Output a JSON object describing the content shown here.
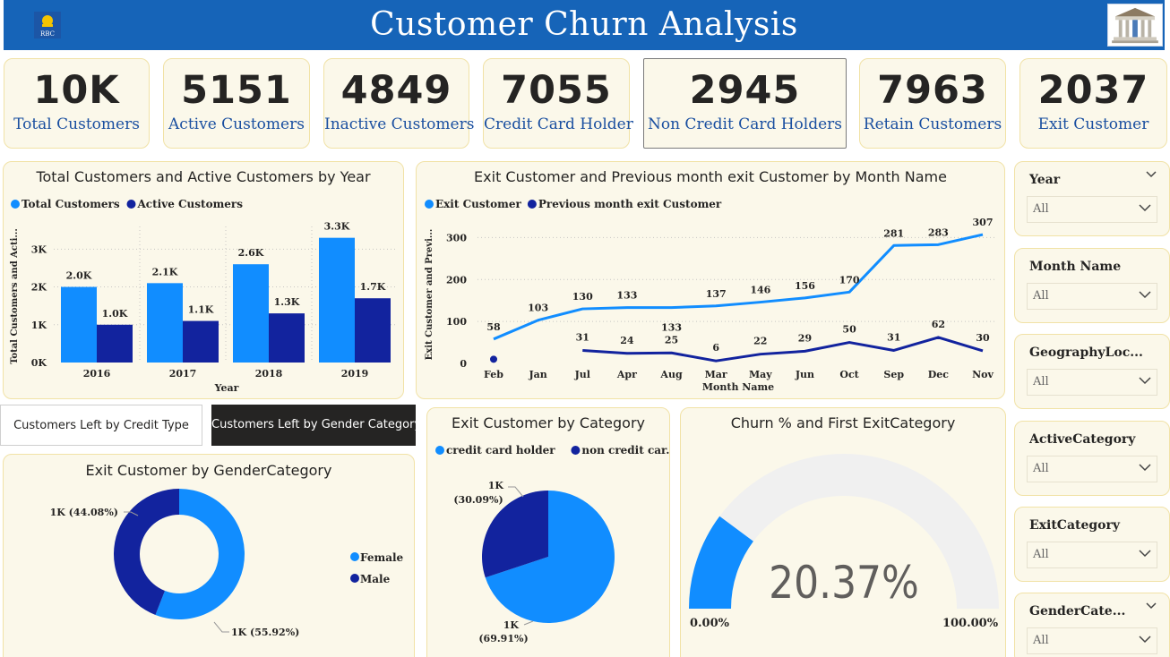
{
  "header": {
    "title": "Customer Churn Analysis",
    "logo_text": "RBC",
    "colors": {
      "header_bg": "#1664b8",
      "panel_bg": "#fbf8ea",
      "primary_blue": "#118dff",
      "dark_blue": "#12239e"
    }
  },
  "cards": [
    {
      "value": "10K",
      "label": "Total Customers"
    },
    {
      "value": "5151",
      "label": "Active Customers"
    },
    {
      "value": "4849",
      "label": "Inactive Customers"
    },
    {
      "value": "7055",
      "label": "Credit Card Holder"
    },
    {
      "value": "2945",
      "label": "Non Credit Card Holders"
    },
    {
      "value": "7963",
      "label": "Retain Customers"
    },
    {
      "value": "2037",
      "label": "Exit Customer"
    }
  ],
  "buttons": {
    "credit_type": "Customers Left by Credit Type",
    "gender_category": "Customers Left by Gender Category"
  },
  "slicers": [
    {
      "title": "Year",
      "value": "All"
    },
    {
      "title": "Month Name",
      "value": "All"
    },
    {
      "title": "GeographyLoc...",
      "value": "All"
    },
    {
      "title": "ActiveCategory",
      "value": "All"
    },
    {
      "title": "ExitCategory",
      "value": "All"
    },
    {
      "title": "GenderCate...",
      "value": "All"
    }
  ],
  "chart_data": [
    {
      "type": "bar",
      "title": "Total Customers and Active Customers by Year",
      "xlabel": "Year",
      "ylabel": "Total Customers and Acti...",
      "categories": [
        "2016",
        "2017",
        "2018",
        "2019"
      ],
      "series": [
        {
          "name": "Total Customers",
          "values": [
            2.0,
            2.1,
            2.6,
            3.3
          ],
          "labels": [
            "2.0K",
            "2.1K",
            "2.6K",
            "3.3K"
          ],
          "color": "#118dff"
        },
        {
          "name": "Active Customers",
          "values": [
            1.0,
            1.1,
            1.3,
            1.7
          ],
          "labels": [
            "1.0K",
            "1.1K",
            "1.3K",
            "1.7K"
          ],
          "color": "#12239e"
        }
      ],
      "yticks": [
        "0K",
        "1K",
        "2K",
        "3K"
      ],
      "ylim": [
        0,
        3.6
      ],
      "unit": "thousands",
      "legend": "top-left",
      "grid": true
    },
    {
      "type": "line",
      "title": "Exit Customer and Previous month exit Customer by Month Name",
      "xlabel": "Month Name",
      "ylabel": "Exit Customer and Previ...",
      "categories": [
        "Feb",
        "Jan",
        "Jul",
        "Apr",
        "Aug",
        "Mar",
        "May",
        "Jun",
        "Oct",
        "Sep",
        "Dec",
        "Nov"
      ],
      "series": [
        {
          "name": "Exit Customer",
          "values": [
            58,
            103,
            130,
            133,
            133,
            137,
            146,
            156,
            170,
            281,
            283,
            307
          ],
          "labels": [
            "58",
            "103",
            "130",
            "133",
            "133",
            "137",
            "146",
            "156",
            "170",
            "281",
            "283",
            "307"
          ],
          "color": "#118dff"
        },
        {
          "name": "Previous month exit Customer",
          "values": [
            null,
            null,
            31,
            24,
            25,
            6,
            22,
            29,
            50,
            31,
            62,
            30
          ],
          "labels": [
            "",
            "",
            "31",
            "24",
            "25",
            "6",
            "22",
            "29",
            "50",
            "31",
            "62",
            "30"
          ],
          "color": "#12239e"
        }
      ],
      "yticks": [
        "0",
        "100",
        "200",
        "300"
      ],
      "ylim": [
        0,
        320
      ],
      "legend": "top-left",
      "grid": true
    },
    {
      "type": "pie",
      "variant": "donut",
      "title": "Exit Customer by GenderCategory",
      "slices": [
        {
          "name": "Female",
          "value": 55.92,
          "label": "1K (55.92%)",
          "color": "#118dff"
        },
        {
          "name": "Male",
          "value": 44.08,
          "label": "1K (44.08%)",
          "color": "#12239e"
        }
      ],
      "legend": "right"
    },
    {
      "type": "pie",
      "title": "Exit Customer by Category",
      "slices": [
        {
          "name": "credit card holder",
          "value": 69.91,
          "label_value": "1K",
          "label_pct": "(69.91%)",
          "color": "#118dff"
        },
        {
          "name": "non credit car...",
          "value": 30.09,
          "label_value": "1K",
          "label_pct": "(30.09%)",
          "color": "#12239e"
        }
      ],
      "legend": "top-left"
    },
    {
      "type": "gauge",
      "title": "Churn % and First ExitCategory",
      "value": 20.37,
      "value_label": "20.37%",
      "min_label": "0.00%",
      "max_label": "100.00%",
      "min": 0,
      "max": 100,
      "fill_color": "#118dff",
      "track_color": "#f0f0f0"
    }
  ]
}
